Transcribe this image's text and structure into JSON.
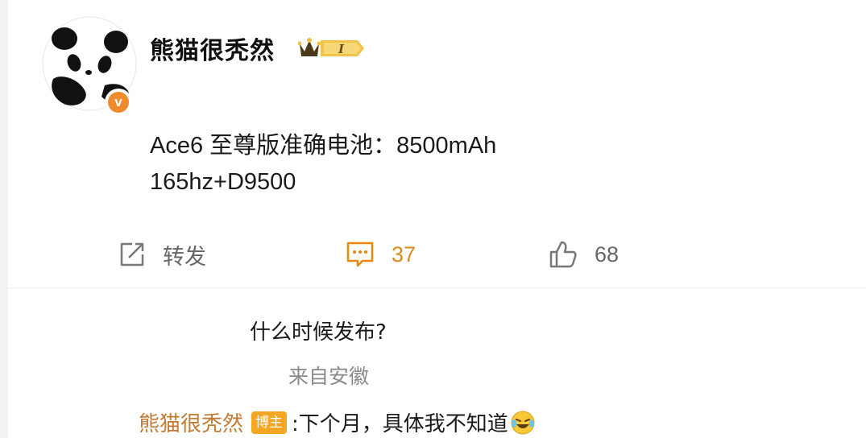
{
  "post": {
    "author": "熊猫很秃然",
    "verified_badge": "v",
    "member_badge_icon": "crown-badge-icon",
    "content_line1": "Ace6 至尊版准确电池：8500mAh",
    "content_line2": "165hz+D9500"
  },
  "actions": {
    "repost_label": "转发",
    "comment_count": "37",
    "like_count": "68"
  },
  "comment": {
    "text": "什么时候发布?",
    "location": "来自安徽"
  },
  "reply": {
    "author": "熊猫很秃然",
    "badge": "博主",
    "text": ":下个月，具体我不知道",
    "emoji_icon": "laughing-crying-emoji-icon"
  },
  "colors": {
    "accent_orange": "#e8890c",
    "reply_name": "#c27a32",
    "badge_bg": "#f5a623",
    "verified": "#f08a2c"
  }
}
